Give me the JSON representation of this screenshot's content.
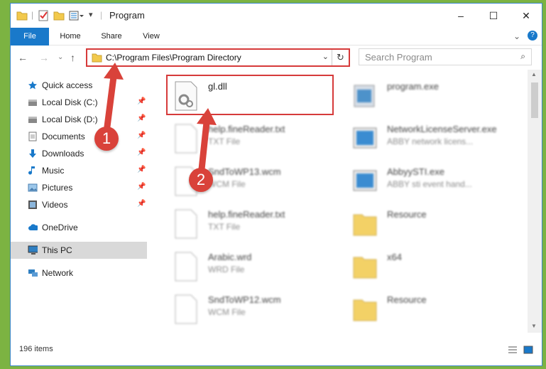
{
  "window": {
    "title": "Program",
    "controls": {
      "minimize": "–",
      "maximize": "☐",
      "close": "✕"
    }
  },
  "ribbon": {
    "tabs": [
      "File",
      "Home",
      "Share",
      "View"
    ]
  },
  "navigation": {
    "address_path": "C:\\Program Files\\Program Directory",
    "search_placeholder": "Search Program"
  },
  "sidebar": {
    "items": [
      {
        "label": "Quick access",
        "icon": "star-icon"
      },
      {
        "label": "Local Disk (C:)",
        "icon": "drive-icon",
        "pinned": true
      },
      {
        "label": "Local Disk (D:)",
        "icon": "drive-icon",
        "pinned": true
      },
      {
        "label": "Documents",
        "icon": "documents-icon",
        "pinned": true
      },
      {
        "label": "Downloads",
        "icon": "downloads-icon",
        "pinned": true
      },
      {
        "label": "Music",
        "icon": "music-icon",
        "pinned": true
      },
      {
        "label": "Pictures",
        "icon": "pictures-icon",
        "pinned": true
      },
      {
        "label": "Videos",
        "icon": "videos-icon",
        "pinned": true
      },
      {
        "label": "OneDrive",
        "icon": "cloud-icon"
      },
      {
        "label": "This PC",
        "icon": "computer-icon",
        "selected": true
      },
      {
        "label": "Network",
        "icon": "network-icon"
      }
    ]
  },
  "files": [
    {
      "name": "gl.dll",
      "type": ""
    },
    {
      "name": "program.exe",
      "type": ""
    },
    {
      "name": "help.fineReader.txt",
      "type": "TXT File"
    },
    {
      "name": "NetworkLicenseServer.exe",
      "type": "ABBY network licens..."
    },
    {
      "name": "SndToWP13.wcm",
      "type": "WCM File"
    },
    {
      "name": "AbbyySTI.exe",
      "type": "ABBY sti event hand..."
    },
    {
      "name": "help.fineReader.txt",
      "type": "TXT File"
    },
    {
      "name": "Resource",
      "type": ""
    },
    {
      "name": "Arabic.wrd",
      "type": "WRD File"
    },
    {
      "name": "x64",
      "type": ""
    },
    {
      "name": "SndToWP12.wcm",
      "type": "WCM File"
    },
    {
      "name": "Resource",
      "type": ""
    }
  ],
  "status": {
    "item_count": "196 items"
  },
  "annotations": {
    "marker1": "1",
    "marker2": "2"
  },
  "colors": {
    "accent": "#1979ca",
    "highlight": "#d63a3a",
    "selected": "#d9d9d9"
  }
}
